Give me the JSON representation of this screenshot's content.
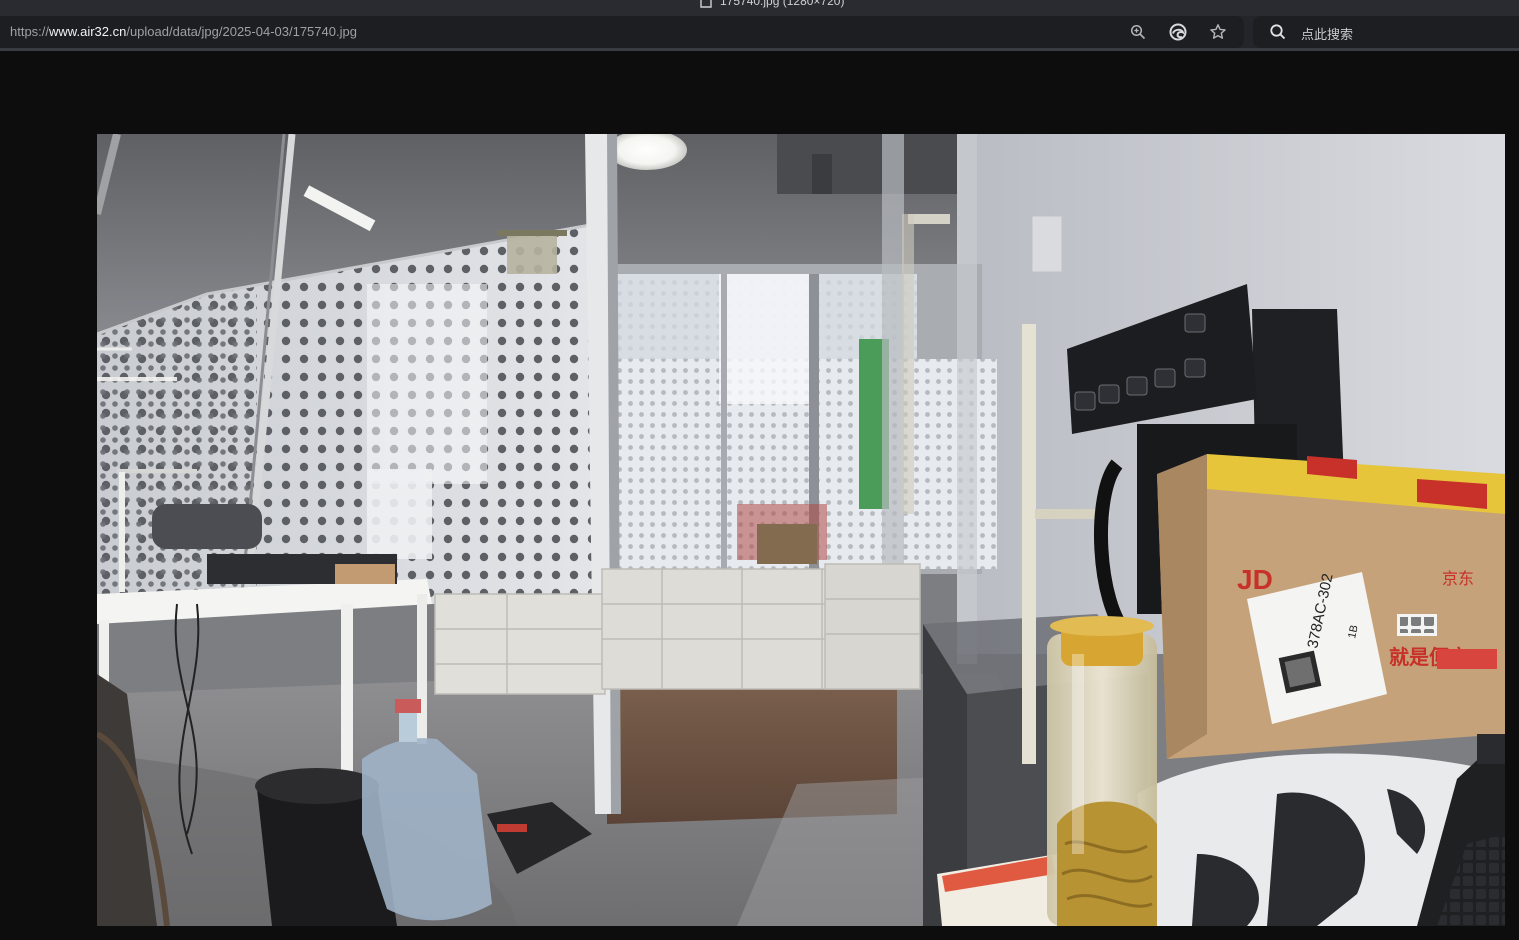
{
  "window": {
    "title": "175740.jpg (1280×720)"
  },
  "address_bar": {
    "url_scheme": "https://",
    "url_domain": "www.air32.cn",
    "url_path": "/upload/data/jpg/2025-04-03/175740.jpg",
    "icons": [
      "zoom-icon",
      "edge-icon",
      "favorite-star-icon"
    ]
  },
  "search": {
    "placeholder": "点此搜索",
    "icon": "search-icon"
  },
  "photo": {
    "labels": {
      "box_brand": "JD",
      "box_code": "378AC-302",
      "box_slogan": "就是便宜",
      "tape_text": "京东",
      "box_jd_cn": "京东",
      "label_sub": "1B"
    }
  },
  "colors": {
    "chrome_bg": "#23252a",
    "url_bg": "#1c1e22",
    "viewer_bg": "#0d0d0e",
    "tape_yellow": "#e6c53a",
    "tape_red": "#c8302a",
    "cardboard": "#c5a27a"
  }
}
